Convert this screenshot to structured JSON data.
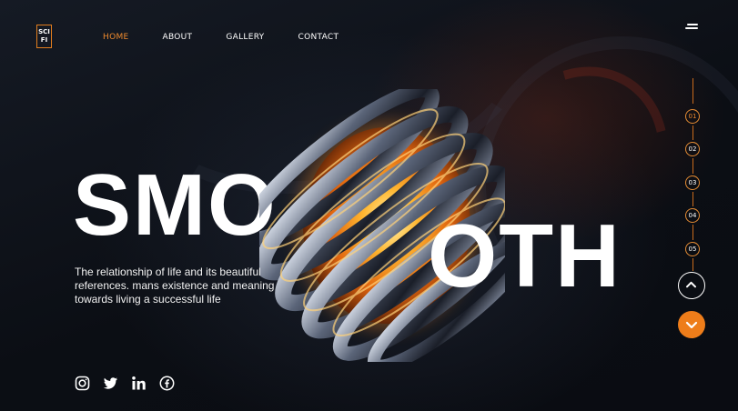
{
  "logo": {
    "line1": "SCI",
    "line2": "FI"
  },
  "nav": {
    "items": [
      "HOME",
      "ABOUT",
      "GALLERY",
      "CONTACT"
    ],
    "active": "HOME"
  },
  "hero": {
    "word_left": "SMO",
    "word_right": "OTH",
    "description": "The relationship of life and its beautiful references. mans existence and meaning towards living a successful life"
  },
  "pager": {
    "pages": [
      "01",
      "02",
      "03",
      "04",
      "05"
    ],
    "active": "01"
  },
  "social": [
    "instagram-icon",
    "twitter-icon",
    "linkedin-icon",
    "facebook-icon"
  ],
  "colors": {
    "accent": "#ee8a2d",
    "background": "#0d1016",
    "text": "#ffffff"
  }
}
